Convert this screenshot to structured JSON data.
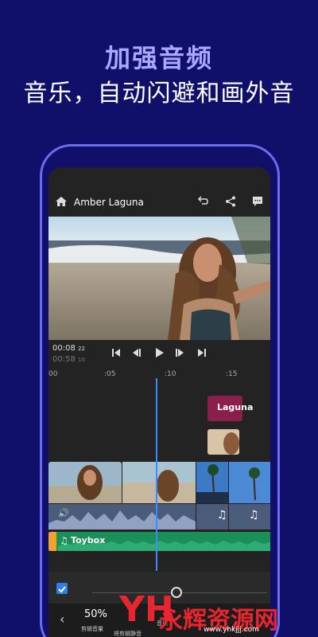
{
  "header": {
    "title": "加强音频",
    "subtitle": "音乐，自动闪避和画外音"
  },
  "app": {
    "project_title": "Amber Laguna",
    "current_time": "00:08",
    "current_frame": "22",
    "total_time": "00:58",
    "total_frame": "10"
  },
  "ruler": {
    "ticks": [
      "00",
      ":05",
      ":10",
      ":15"
    ]
  },
  "timeline": {
    "title_clip_label": "Laguna",
    "music_track_label": "Toybox"
  },
  "panel": {
    "volume_value": "50%",
    "volume_label": "剪辑音量",
    "mute_label": "将剪辑静音",
    "extra_label": "音乐"
  },
  "watermark": {
    "logo": "YH",
    "text": "永辉资源网",
    "url": "www.yhkjjj.com"
  },
  "colors": {
    "background": "#10106a",
    "accent": "#a9a7ff",
    "playhead": "#3d8bff",
    "music_track": "#1a8f5a",
    "title_clip": "#8b1e4a"
  }
}
